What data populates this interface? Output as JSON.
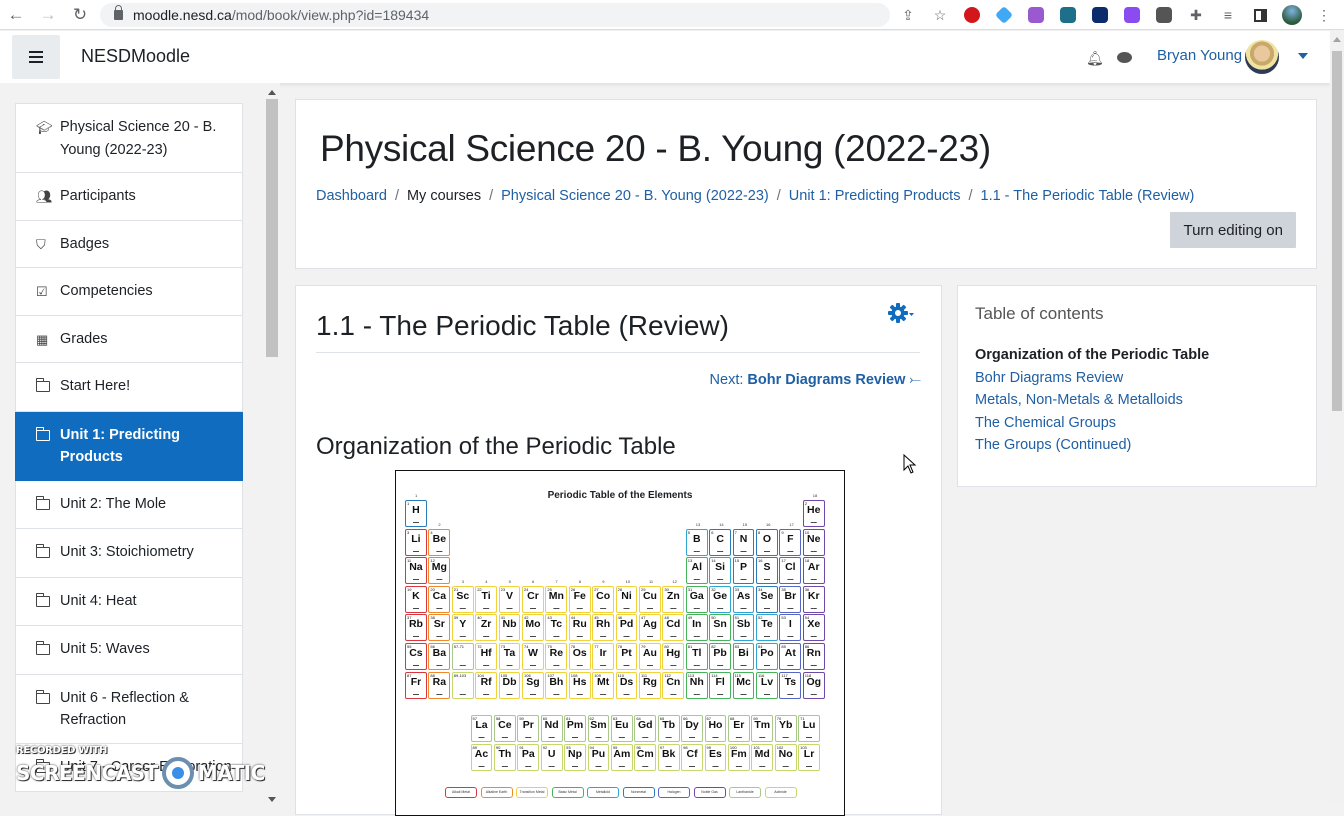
{
  "browser": {
    "url_host": "moodle.nesd.ca",
    "url_path": "/mod/book/view.php?id=189434",
    "extensions": [
      {
        "name": "ublock-icon",
        "color": "#d3161b"
      },
      {
        "name": "diamond-ext-icon",
        "color": "#3fa9f5"
      },
      {
        "name": "readwrite-icon",
        "color": "#9b59d0"
      },
      {
        "name": "planet-ext-icon",
        "color": "#1e6f8a"
      },
      {
        "name": "dashlane-icon",
        "color": "#0c2d6b"
      },
      {
        "name": "purple-ext-icon",
        "color": "#8a4cf0"
      },
      {
        "name": "screencast-ext-icon",
        "color": "#555555"
      }
    ]
  },
  "navbar": {
    "brand": "NESDMoodle",
    "user_name": "Bryan Young"
  },
  "sidebar": {
    "items": [
      {
        "label": "Physical Science 20 - B. Young (2022-23)",
        "icon": "graduation-cap-icon",
        "active": false
      },
      {
        "label": "Participants",
        "icon": "users-icon",
        "active": false
      },
      {
        "label": "Badges",
        "icon": "shield-icon",
        "active": false
      },
      {
        "label": "Competencies",
        "icon": "checkbox-icon",
        "active": false
      },
      {
        "label": "Grades",
        "icon": "table-icon",
        "active": false
      },
      {
        "label": "Start Here!",
        "icon": "folder-icon",
        "active": false
      },
      {
        "label": "Unit 1: Predicting Products",
        "icon": "folder-icon",
        "active": true
      },
      {
        "label": "Unit 2: The Mole",
        "icon": "folder-icon",
        "active": false
      },
      {
        "label": "Unit 3: Stoichiometry",
        "icon": "folder-icon",
        "active": false
      },
      {
        "label": "Unit 4: Heat",
        "icon": "folder-icon",
        "active": false
      },
      {
        "label": "Unit 5: Waves",
        "icon": "folder-icon",
        "active": false
      },
      {
        "label": "Unit 6 - Reflection & Refraction",
        "icon": "folder-icon",
        "active": false
      },
      {
        "label": "Unit 7 - Career Exploration",
        "icon": "folder-icon",
        "active": false
      }
    ]
  },
  "header": {
    "title": "Physical Science 20 - B. Young (2022-23)",
    "breadcrumbs": [
      {
        "label": "Dashboard",
        "link": true
      },
      {
        "label": "My courses",
        "link": false
      },
      {
        "label": "Physical Science 20 - B. Young (2022-23)",
        "link": true
      },
      {
        "label": "Unit 1: Predicting Products",
        "link": true
      },
      {
        "label": "1.1 - The Periodic Table (Review)",
        "link": true
      }
    ],
    "edit_button": "Turn editing on"
  },
  "content": {
    "chapter_title": "1.1 - The Periodic Table (Review)",
    "next_prefix": "Next:",
    "next_label": "Bohr Diagrams Review",
    "next_arrow": "⤚",
    "section_title": "Organization of the Periodic Table",
    "periodic_table": {
      "title": "Periodic Table of the Elements",
      "colors": {
        "alkali": "#d9363e",
        "alkaline": "#ee8a2a",
        "transition": "#f1d23a",
        "basic": "#46b25a",
        "metalloid": "#2fa6d1",
        "nonmetal": "#2a7bb8",
        "halogen": "#5566c4",
        "noble": "#6e49a8",
        "lanthanide": "#a8c98a",
        "actinide": "#c6d76b"
      },
      "rows": [
        [
          [
            "H",
            "hydrogen",
            1,
            1,
            "nonmetal"
          ],
          [
            "He",
            "noble",
            2,
            18,
            "noble"
          ]
        ],
        [
          [
            "Li",
            "alkali",
            3,
            1
          ],
          [
            "Be",
            "alkaline",
            4,
            2
          ],
          [
            "B",
            "metalloid",
            5,
            13
          ],
          [
            "C",
            "nonmetal",
            6,
            14
          ],
          [
            "N",
            "nonmetal",
            7,
            15
          ],
          [
            "O",
            "nonmetal",
            8,
            16
          ],
          [
            "F",
            "halogen",
            9,
            17
          ],
          [
            "Ne",
            "noble",
            10,
            18
          ]
        ],
        [
          [
            "Na",
            "alkali",
            11,
            1
          ],
          [
            "Mg",
            "alkaline",
            12,
            2
          ],
          [
            "Al",
            "basic",
            13,
            13
          ],
          [
            "Si",
            "metalloid",
            14,
            14
          ],
          [
            "P",
            "nonmetal",
            15,
            15
          ],
          [
            "S",
            "nonmetal",
            16,
            16
          ],
          [
            "Cl",
            "halogen",
            17,
            17
          ],
          [
            "Ar",
            "noble",
            18,
            18
          ]
        ],
        [
          [
            "K",
            "alkali",
            19,
            1
          ],
          [
            "Ca",
            "alkaline",
            20,
            2
          ],
          [
            "Sc",
            "transition",
            21,
            3
          ],
          [
            "Ti",
            "transition",
            22,
            4
          ],
          [
            "V",
            "transition",
            23,
            5
          ],
          [
            "Cr",
            "transition",
            24,
            6
          ],
          [
            "Mn",
            "transition",
            25,
            7
          ],
          [
            "Fe",
            "transition",
            26,
            8
          ],
          [
            "Co",
            "transition",
            27,
            9
          ],
          [
            "Ni",
            "transition",
            28,
            10
          ],
          [
            "Cu",
            "transition",
            29,
            11
          ],
          [
            "Zn",
            "transition",
            30,
            12
          ],
          [
            "Ga",
            "basic",
            31,
            13
          ],
          [
            "Ge",
            "metalloid",
            32,
            14
          ],
          [
            "As",
            "metalloid",
            33,
            15
          ],
          [
            "Se",
            "nonmetal",
            34,
            16
          ],
          [
            "Br",
            "halogen",
            35,
            17
          ],
          [
            "Kr",
            "noble",
            36,
            18
          ]
        ],
        [
          [
            "Rb",
            "alkali",
            37,
            1
          ],
          [
            "Sr",
            "alkaline",
            38,
            2
          ],
          [
            "Y",
            "transition",
            39,
            3
          ],
          [
            "Zr",
            "transition",
            40,
            4
          ],
          [
            "Nb",
            "transition",
            41,
            5
          ],
          [
            "Mo",
            "transition",
            42,
            6
          ],
          [
            "Tc",
            "transition",
            43,
            7
          ],
          [
            "Ru",
            "transition",
            44,
            8
          ],
          [
            "Rh",
            "transition",
            45,
            9
          ],
          [
            "Pd",
            "transition",
            46,
            10
          ],
          [
            "Ag",
            "transition",
            47,
            11
          ],
          [
            "Cd",
            "transition",
            48,
            12
          ],
          [
            "In",
            "basic",
            49,
            13
          ],
          [
            "Sn",
            "basic",
            50,
            14
          ],
          [
            "Sb",
            "metalloid",
            51,
            15
          ],
          [
            "Te",
            "metalloid",
            52,
            16
          ],
          [
            "I",
            "halogen",
            53,
            17
          ],
          [
            "Xe",
            "noble",
            54,
            18
          ]
        ],
        [
          [
            "Cs",
            "alkali",
            55,
            1
          ],
          [
            "Ba",
            "alkaline",
            56,
            2
          ],
          [
            "",
            "lanthanide",
            "57-71",
            3
          ],
          [
            "Hf",
            "transition",
            72,
            4
          ],
          [
            "Ta",
            "transition",
            73,
            5
          ],
          [
            "W",
            "transition",
            74,
            6
          ],
          [
            "Re",
            "transition",
            75,
            7
          ],
          [
            "Os",
            "transition",
            76,
            8
          ],
          [
            "Ir",
            "transition",
            77,
            9
          ],
          [
            "Pt",
            "transition",
            78,
            10
          ],
          [
            "Au",
            "transition",
            79,
            11
          ],
          [
            "Hg",
            "transition",
            80,
            12
          ],
          [
            "Tl",
            "basic",
            81,
            13
          ],
          [
            "Pb",
            "basic",
            82,
            14
          ],
          [
            "Bi",
            "basic",
            83,
            15
          ],
          [
            "Po",
            "metalloid",
            84,
            16
          ],
          [
            "At",
            "halogen",
            85,
            17
          ],
          [
            "Rn",
            "noble",
            86,
            18
          ]
        ],
        [
          [
            "Fr",
            "alkali",
            87,
            1
          ],
          [
            "Ra",
            "alkaline",
            88,
            2
          ],
          [
            "",
            "actinide",
            "89-103",
            3
          ],
          [
            "Rf",
            "transition",
            104,
            4
          ],
          [
            "Db",
            "transition",
            105,
            5
          ],
          [
            "Sg",
            "transition",
            106,
            6
          ],
          [
            "Bh",
            "transition",
            107,
            7
          ],
          [
            "Hs",
            "transition",
            108,
            8
          ],
          [
            "Mt",
            "transition",
            109,
            9
          ],
          [
            "Ds",
            "transition",
            110,
            10
          ],
          [
            "Rg",
            "transition",
            111,
            11
          ],
          [
            "Cn",
            "transition",
            112,
            12
          ],
          [
            "Nh",
            "basic",
            113,
            13
          ],
          [
            "Fl",
            "basic",
            114,
            14
          ],
          [
            "Mc",
            "basic",
            115,
            15
          ],
          [
            "Lv",
            "basic",
            116,
            16
          ],
          [
            "Ts",
            "halogen",
            117,
            17
          ],
          [
            "Og",
            "noble",
            118,
            18
          ]
        ]
      ],
      "lanthanides": [
        "La",
        "Ce",
        "Pr",
        "Nd",
        "Pm",
        "Sm",
        "Eu",
        "Gd",
        "Tb",
        "Dy",
        "Ho",
        "Er",
        "Tm",
        "Yb",
        "Lu"
      ],
      "actinides": [
        "Ac",
        "Th",
        "Pa",
        "U",
        "Np",
        "Pu",
        "Am",
        "Cm",
        "Bk",
        "Cf",
        "Es",
        "Fm",
        "Md",
        "No",
        "Lr"
      ],
      "legend": [
        {
          "label": "Alkali Metal",
          "key": "alkali"
        },
        {
          "label": "Alkaline Earth",
          "key": "alkaline"
        },
        {
          "label": "Transition Metal",
          "key": "transition"
        },
        {
          "label": "Basic Metal",
          "key": "basic"
        },
        {
          "label": "Metalloid",
          "key": "metalloid"
        },
        {
          "label": "Nonmetal",
          "key": "nonmetal"
        },
        {
          "label": "Halogen",
          "key": "halogen"
        },
        {
          "label": "Noble Gas",
          "key": "noble"
        },
        {
          "label": "Lanthanide",
          "key": "lanthanide"
        },
        {
          "label": "Actinide",
          "key": "actinide"
        }
      ]
    }
  },
  "toc": {
    "title": "Table of contents",
    "items": [
      {
        "label": "Organization of the Periodic Table",
        "current": true
      },
      {
        "label": "Bohr Diagrams Review",
        "current": false
      },
      {
        "label": "Metals, Non-Metals & Metalloids",
        "current": false
      },
      {
        "label": "The Chemical Groups",
        "current": false
      },
      {
        "label": "The Groups (Continued)",
        "current": false
      }
    ]
  },
  "watermark": {
    "line1": "RECORDED WITH",
    "left": "SCREENCAST",
    "right": "MATIC"
  }
}
